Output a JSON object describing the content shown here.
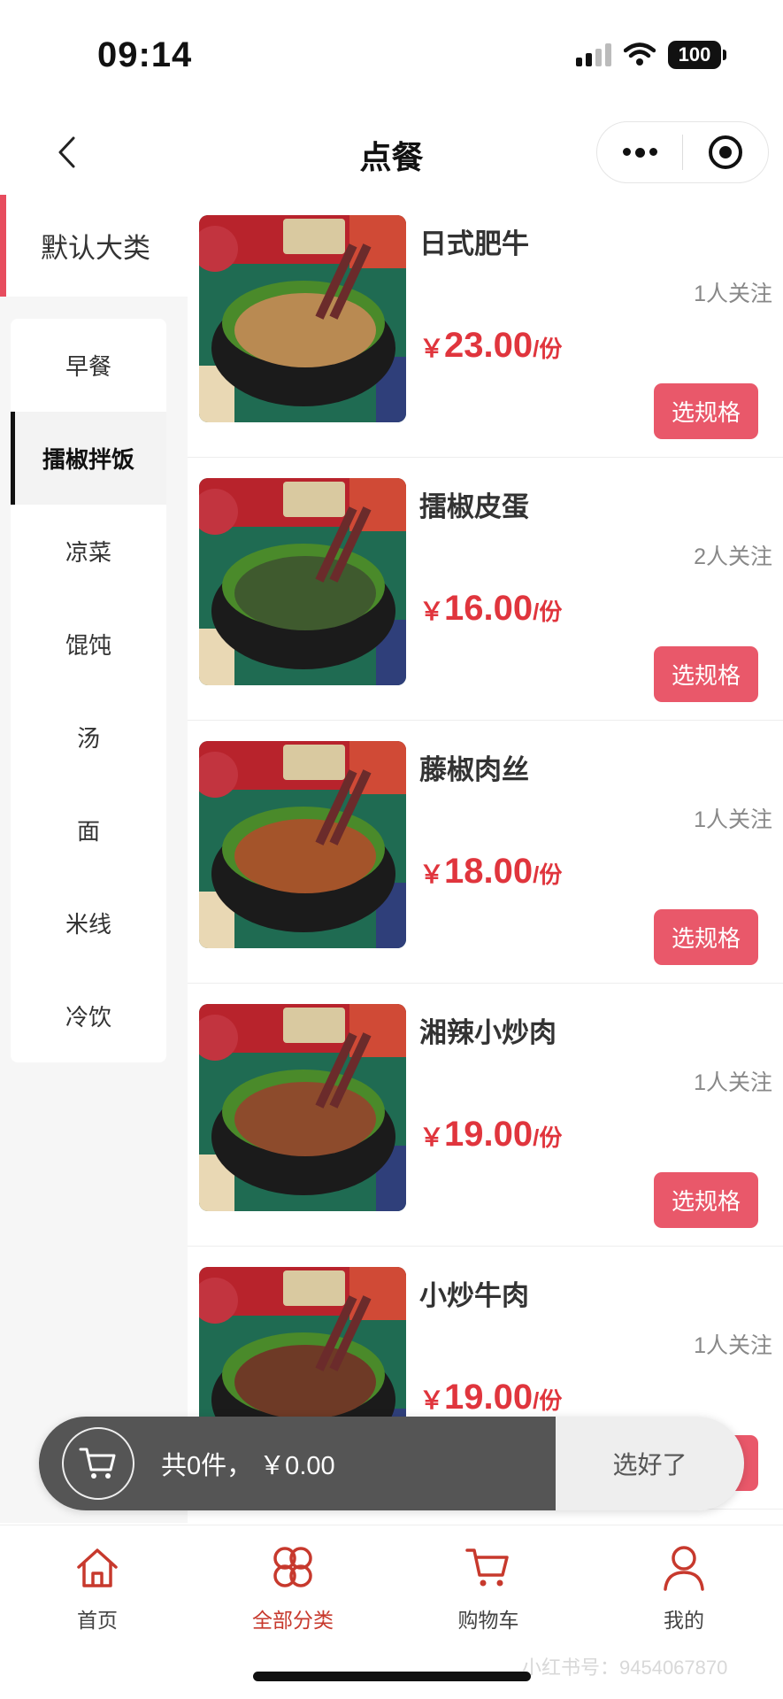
{
  "status_bar": {
    "time": "09:14",
    "battery": "100"
  },
  "nav": {
    "title": "点餐"
  },
  "sidebar": {
    "default_category": "默认大类",
    "items": [
      {
        "label": "早餐",
        "active": false
      },
      {
        "label": "擂椒拌饭",
        "active": true
      },
      {
        "label": "凉菜",
        "active": false
      },
      {
        "label": "馄饨",
        "active": false
      },
      {
        "label": "汤",
        "active": false
      },
      {
        "label": "面",
        "active": false
      },
      {
        "label": "米线",
        "active": false
      },
      {
        "label": "冷饮",
        "active": false
      }
    ]
  },
  "products": [
    {
      "name": "日式肥牛",
      "followers": "1人关注",
      "currency": "￥",
      "price": "23.00",
      "unit": "/份",
      "button": "选规格",
      "topping": "#b98a52"
    },
    {
      "name": "擂椒皮蛋",
      "followers": "2人关注",
      "currency": "￥",
      "price": "16.00",
      "unit": "/份",
      "button": "选规格",
      "topping": "#3f5a2e"
    },
    {
      "name": "藤椒肉丝",
      "followers": "1人关注",
      "currency": "￥",
      "price": "18.00",
      "unit": "/份",
      "button": "选规格",
      "topping": "#a4542a"
    },
    {
      "name": "湘辣小炒肉",
      "followers": "1人关注",
      "currency": "￥",
      "price": "19.00",
      "unit": "/份",
      "button": "选规格",
      "topping": "#8d4b2c"
    },
    {
      "name": "小炒牛肉",
      "followers": "1人关注",
      "currency": "￥",
      "price": "19.00",
      "unit": "/份",
      "button": "选规格",
      "topping": "#6e3a26"
    }
  ],
  "cart": {
    "summary": "共0件，  ￥0.00",
    "checkout": "选好了"
  },
  "tabs": [
    {
      "label": "首页",
      "icon": "home-icon",
      "active": false
    },
    {
      "label": "全部分类",
      "icon": "category-icon",
      "active": true
    },
    {
      "label": "购物车",
      "icon": "cart-icon",
      "active": false
    },
    {
      "label": "我的",
      "icon": "user-icon",
      "active": false
    }
  ],
  "watermark": "小红书号：9454067870",
  "colors": {
    "accent": "#e9586a",
    "price": "#e0353d",
    "tab_active": "#c7392d",
    "cart_dark": "#555555"
  }
}
